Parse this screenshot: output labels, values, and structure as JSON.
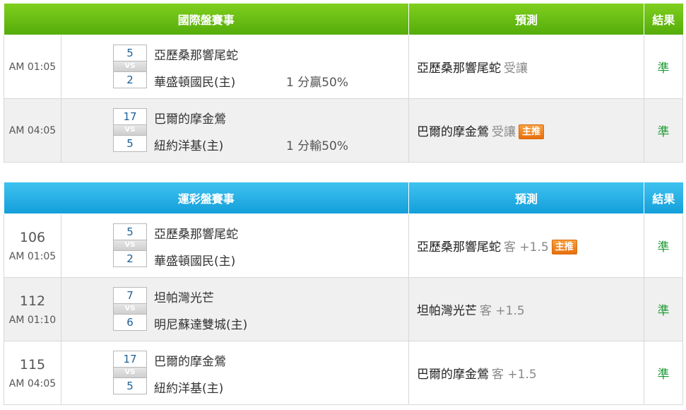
{
  "international": {
    "header": {
      "title": "國際盤賽事",
      "prediction": "預測",
      "result": "結果"
    },
    "rows": [
      {
        "num": "",
        "time": "AM 01:05",
        "away_score": "5",
        "away_team": "亞歷桑那響尾蛇",
        "vs": "VS",
        "home_score": "2",
        "home_team": "華盛頓國民(主)",
        "handicap": "1 分贏50%",
        "pred_team": "亞歷桑那響尾蛇",
        "pred_side": "受讓",
        "badge": "",
        "result": "準"
      },
      {
        "num": "",
        "time": "AM 04:05",
        "away_score": "17",
        "away_team": "巴爾的摩金鶯",
        "vs": "VS",
        "home_score": "5",
        "home_team": "紐約洋基(主)",
        "handicap": "1 分輸50%",
        "pred_team": "巴爾的摩金鶯",
        "pred_side": "受讓",
        "badge": "主推",
        "result": "準"
      }
    ]
  },
  "lottery": {
    "header": {
      "title": "運彩盤賽事",
      "prediction": "預測",
      "result": "結果"
    },
    "rows": [
      {
        "num": "106",
        "time": "AM 01:05",
        "away_score": "5",
        "away_team": "亞歷桑那響尾蛇",
        "vs": "VS",
        "home_score": "2",
        "home_team": "華盛頓國民(主)",
        "handicap": "",
        "pred_team": "亞歷桑那響尾蛇",
        "pred_side": "客 +1.5",
        "badge": "主推",
        "result": "準"
      },
      {
        "num": "112",
        "time": "AM 01:10",
        "away_score": "7",
        "away_team": "坦帕灣光芒",
        "vs": "VS",
        "home_score": "6",
        "home_team": "明尼蘇達雙城(主)",
        "handicap": "",
        "pred_team": "坦帕灣光芒",
        "pred_side": "客 +1.5",
        "badge": "",
        "result": "準"
      },
      {
        "num": "115",
        "time": "AM 04:05",
        "away_score": "17",
        "away_team": "巴爾的摩金鶯",
        "vs": "VS",
        "home_score": "5",
        "home_team": "紐約洋基(主)",
        "handicap": "",
        "pred_team": "巴爾的摩金鶯",
        "pred_side": "客 +1.5",
        "badge": "",
        "result": "準"
      }
    ]
  }
}
